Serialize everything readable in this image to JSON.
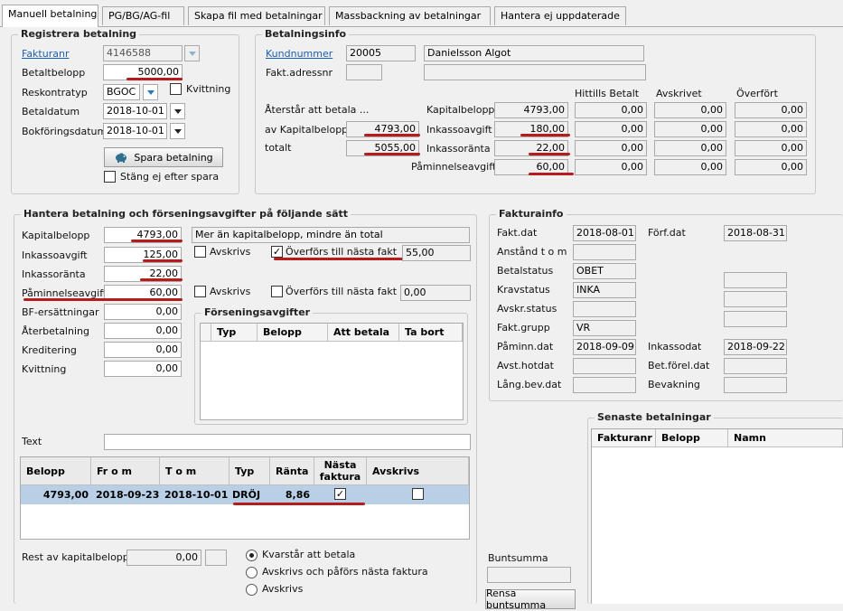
{
  "tabs": [
    "Manuell betalning",
    "PG/BG/AG-fil",
    "Skapa fil med betalningar",
    "Massbackning av betalningar",
    "Hantera ej uppdaterade"
  ],
  "registrera": {
    "legend": "Registrera betalning",
    "fakturanr_label": "Fakturanr",
    "fakturanr_value": "4146588",
    "betaltbelopp_label": "Betaltbelopp",
    "betaltbelopp_value": "5000,00",
    "reskontratyp_label": "Reskontratyp",
    "reskontratyp_value": "BGOC",
    "kvittning_label": "Kvittning",
    "betaldatum_label": "Betaldatum",
    "betaldatum_value": "2018-10-01",
    "bokforingsdatum_label": "Bokföringsdatum",
    "bokforingsdatum_value": "2018-10-01",
    "spara_label": "Spara betalning",
    "stang_label": "Stäng ej efter spara"
  },
  "betalningsinfo": {
    "legend": "Betalningsinfo",
    "kundnummer_label": "Kundnummer",
    "kundnummer_value": "20005",
    "kundnamn": "Danielsson Algot",
    "faktadress_label": "Fakt.adressnr",
    "faktadress_value": "",
    "aterstar_label": "Återstår att betala ...",
    "av_kapital_label": "av Kapitalbelopp",
    "av_kapital_value": "4793,00",
    "totalt_label": "totalt",
    "totalt_value": "5055,00",
    "col_hittills": "Hittills Betalt",
    "col_avskrivet": "Avskrivet",
    "col_overfort": "Överfört",
    "rows": [
      {
        "label": "Kapitalbelopp",
        "amount": "4793,00",
        "hittills": "0,00",
        "avskrivet": "0,00",
        "overfort": "0,00"
      },
      {
        "label": "Inkassoavgift",
        "amount": "180,00",
        "hittills": "0,00",
        "avskrivet": "0,00",
        "overfort": "0,00"
      },
      {
        "label": "Inkassoränta",
        "amount": "22,00",
        "hittills": "0,00",
        "avskrivet": "0,00",
        "overfort": "0,00"
      },
      {
        "label": "Påminnelseavgift",
        "amount": "60,00",
        "hittills": "0,00",
        "avskrivet": "0,00",
        "overfort": "0,00"
      }
    ]
  },
  "hantera": {
    "legend": "Hantera betalning och förseningsavgifter på följande sätt",
    "kapitalbelopp_label": "Kapitalbelopp",
    "kapitalbelopp_value": "4793,00",
    "note": "Mer än kapitalbelopp, mindre än total",
    "inkassoavgift_label": "Inkassoavgift",
    "inkassoavgift_value": "125,00",
    "avskrivs_label": "Avskrivs",
    "overfors_label": "Överförs till nästa fakt",
    "overfors1_value": "55,00",
    "inkassoranta_label": "Inkassoränta",
    "inkassoranta_value": "22,00",
    "paminnelse_label": "Påminnelseavgift",
    "paminnelse_value": "60,00",
    "overfors2_value": "0,00",
    "bf_label": "BF-ersättningar",
    "bf_value": "0,00",
    "aterbetalning_label": "Återbetalning",
    "aterbetalning_value": "0,00",
    "kreditering_label": "Kreditering",
    "kreditering_value": "0,00",
    "kvittning_label": "Kvittning",
    "kvittning_value": "0,00",
    "forsening": {
      "legend": "Förseningsavgifter",
      "headers": [
        "Typ",
        "Belopp",
        "Att betala",
        "Ta bort"
      ]
    },
    "text_label": "Text",
    "main_grid": {
      "headers": [
        "Belopp",
        "Fr o m",
        "T o m",
        "Typ",
        "Ränta",
        "Nästa faktura",
        "Avskrivs"
      ],
      "row": {
        "belopp": "4793,00",
        "from": "2018-09-23",
        "tom": "2018-10-01",
        "typ": "DRÖJ",
        "ranta": "8,86",
        "nasta": "✓",
        "avskrivs": ""
      }
    },
    "rest_label": "Rest av kapitalbelopp",
    "rest_value": "0,00",
    "radio1": "Kvarstår att betala",
    "radio2": "Avskrivs och påförs nästa faktura",
    "radio3": "Avskrivs"
  },
  "fakturainfo": {
    "legend": "Fakturainfo",
    "faktdat_label": "Fakt.dat",
    "faktdat_value": "2018-08-01",
    "forfdat_label": "Förf.dat",
    "forfdat_value": "2018-08-31",
    "anstand_label": "Anstånd t o m",
    "betalstatus_label": "Betalstatus",
    "betalstatus_value": "OBET",
    "kravstatus_label": "Kravstatus",
    "kravstatus_value": "INKA",
    "avskrstatus_label": "Avskr.status",
    "faktgrupp_label": "Fakt.grupp",
    "faktgrupp_value": "VR",
    "paminn_label": "Påminn.dat",
    "paminn_value": "2018-09-09",
    "inkassodat_label": "Inkassodat",
    "inkassodat_value": "2018-09-22",
    "avsthot_label": "Avst.hotdat",
    "betforel_label": "Bet.förel.dat",
    "langbev_label": "Lång.bev.dat",
    "bevakning_label": "Bevakning"
  },
  "senaste": {
    "legend": "Senaste betalningar",
    "headers": [
      "Fakturanr",
      "Belopp",
      "Namn"
    ]
  },
  "buntsumma_label": "Buntsumma",
  "rensa_label": "Rensa buntsumma",
  "colors": {
    "underline": "#b71c1c",
    "link": "#1a5fb4",
    "selected_row": "#b9cfe6"
  }
}
